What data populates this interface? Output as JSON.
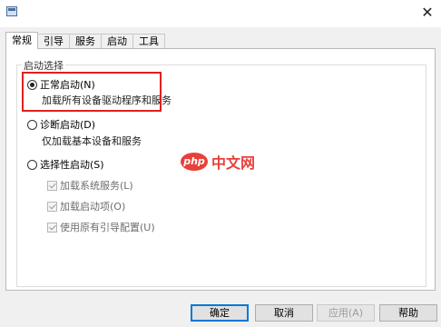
{
  "window": {
    "icon": "msconfig-icon",
    "close_glyph": "✕"
  },
  "tabs": [
    {
      "label": "常规",
      "active": true
    },
    {
      "label": "引导",
      "active": false
    },
    {
      "label": "服务",
      "active": false
    },
    {
      "label": "启动",
      "active": false
    },
    {
      "label": "工具",
      "active": false
    }
  ],
  "startup_group": {
    "legend": "启动选择",
    "options": [
      {
        "label": "正常启动(N)",
        "description": "加载所有设备驱动程序和服务",
        "checked": true
      },
      {
        "label": "诊断启动(D)",
        "description": "仅加载基本设备和服务",
        "checked": false
      },
      {
        "label": "选择性启动(S)",
        "checked": false
      }
    ],
    "sub_options": [
      {
        "label": "加载系统服务(L)",
        "checked": true,
        "disabled": true
      },
      {
        "label": "加载启动项(O)",
        "checked": true,
        "disabled": true
      },
      {
        "label": "使用原有引导配置(U)",
        "checked": true,
        "disabled": true
      }
    ]
  },
  "watermark": {
    "logo_text": "php",
    "text": "中文网"
  },
  "buttons": {
    "ok": "确定",
    "cancel": "取消",
    "apply": "应用(A)",
    "help": "帮助"
  },
  "colors": {
    "highlight_border": "#e02020",
    "default_button_border": "#0078d7",
    "watermark": "#e8403a"
  }
}
